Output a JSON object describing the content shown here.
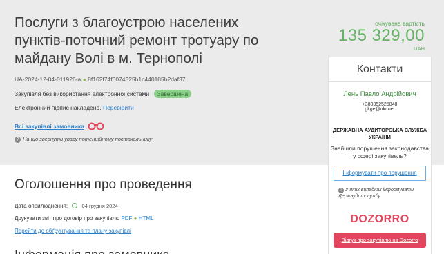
{
  "tender": {
    "title": "Послуги з благоустрою населених пунктів-поточний ремонт тротуару по майдану Волі в м. Тернополі",
    "id": "UA-2024-12-04-011926-a",
    "hash": "8f162f74f0074325b1c440185b2daf37",
    "procedure": "Закупівля без використання електронної системи",
    "status": "Завершена",
    "esign_text": "Електронний підпис накладено.",
    "esign_link": "Перевірити",
    "all_purchases": "Всі закупівлі замовника",
    "hint": "На що звернути увагу потенційному постачальнику"
  },
  "price": {
    "label": "очікувана вартість",
    "value": "135 329,00",
    "currency": "UAH"
  },
  "contacts": {
    "heading": "Контакти",
    "name": "Лень Павло Андрійович",
    "phone": "+380352525848",
    "email": "gkge@ukr.net",
    "audit_title": "ДЕРЖАВНА АУДИТОРСЬКА СЛУЖБА УКРАЇНИ",
    "audit_question": "Знайшли порушення законодавства у сфері закупівель?",
    "inform_button": "Інформувати про порушення",
    "cases_text": "У яких випадках інформувати Держаудитслужбу",
    "dozorro_logo": "DOZORRO",
    "dozorro_button": "Відгук про закупівлю на Dozorro"
  },
  "announcement": {
    "title": "Оголошення про проведення",
    "date_label": "Дата оприлюднення:",
    "date_value": "04 грудня 2024",
    "print_label": "Друкувати звіт про договір про закупівлю",
    "pdf": "PDF",
    "html": "HTML",
    "goto_link": "Перейти до обґрунтування та плану закупівлі",
    "cut_text": "Інформація про замовника"
  },
  "icons": {
    "binoculars": "binoculars-icon",
    "question": "question-icon",
    "clock": "clock-icon"
  }
}
